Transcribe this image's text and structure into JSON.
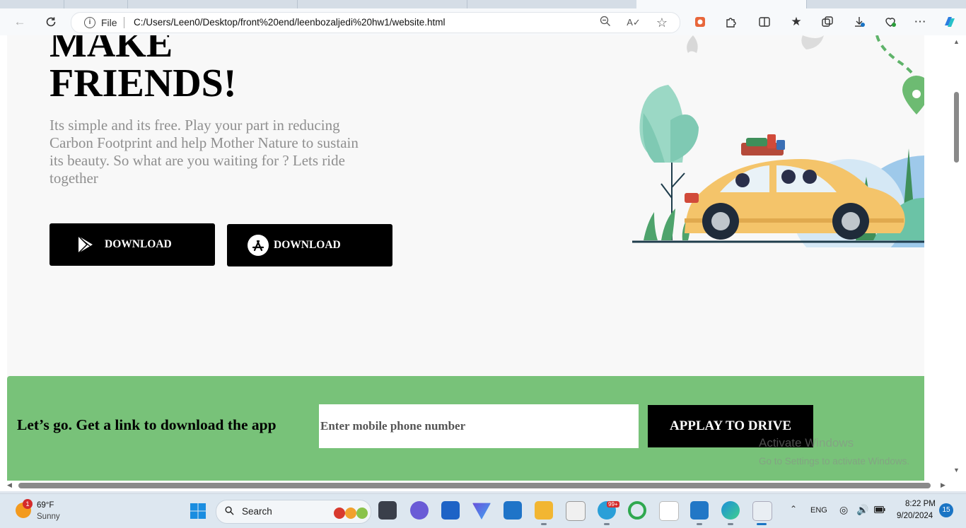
{
  "browser": {
    "file_label": "File",
    "url": "C:/Users/Leen0/Desktop/front%20end/leenbozaljedi%20hw1/website.html"
  },
  "hero": {
    "title_line1": "MAKE",
    "title_line2": "FRIENDS!",
    "description": "Its simple and its free. Play your part in reducing Carbon Footprint and help Mother Nature to sustain its beauty. So what are you waiting for ? Lets ride together",
    "google_play_button": "DOWNLOAD",
    "app_store_button": "DOWNLOAD"
  },
  "banner": {
    "text": "Let’s go. Get a link to download the app",
    "phone_placeholder": "Enter mobile phone number",
    "apply_button": "APPLAY TO DRIVE"
  },
  "watermark": {
    "line1": "Activate Windows",
    "line2": "Go to Settings to activate Windows."
  },
  "taskbar": {
    "weather_badge": "1",
    "temperature": "69°F",
    "condition": "Sunny",
    "search_label": "Search",
    "language": "ENG",
    "time": "8:22 PM",
    "date": "9/20/2024",
    "notification_count": "15",
    "telegram_badge": "99+"
  },
  "colors": {
    "banner_green": "#78c279",
    "button_black": "#000000",
    "description_gray": "#8f8f8f",
    "page_background": "#f8f8f8"
  }
}
